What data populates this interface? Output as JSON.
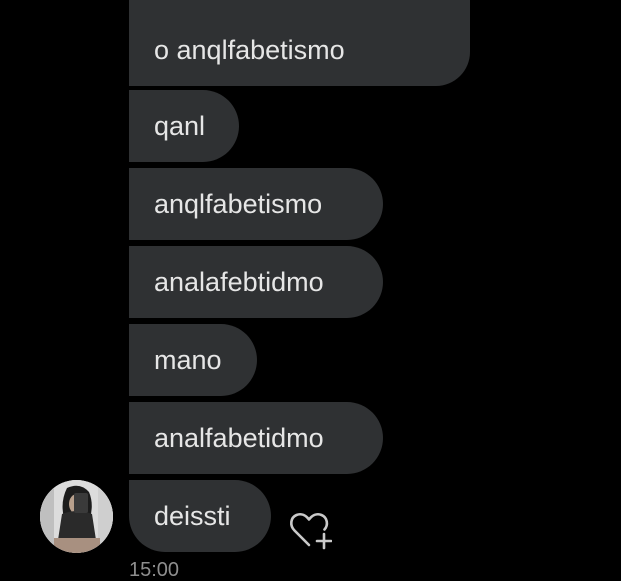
{
  "messages": [
    {
      "text": "o anqlfabetismo"
    },
    {
      "text": "qanl"
    },
    {
      "text": "anqlfabetismo"
    },
    {
      "text": "analafebtidmo"
    },
    {
      "text": "mano"
    },
    {
      "text": "analfabetidmo"
    },
    {
      "text": "deissti"
    }
  ],
  "icons": {
    "reaction": "heart-plus-icon",
    "avatar": "user-avatar"
  },
  "colors": {
    "background": "#000000",
    "bubble": "#2f3133",
    "text": "#e6e6e6",
    "timestamp": "#8e8e8e"
  },
  "timestamp": "15:00"
}
